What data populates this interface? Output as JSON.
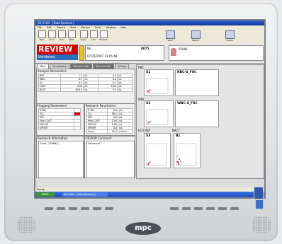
{
  "window": {
    "title": "XE-2100 - [Data Browser]"
  },
  "menubar": {
    "items": [
      "File",
      "Edit",
      "Search",
      "View",
      "Record",
      "Tools",
      "Window",
      "Help"
    ]
  },
  "toolbar": {
    "buttons": [
      "Help",
      "Print",
      "Prev",
      "Next",
      "Query",
      "List",
      "Explore",
      "Valid",
      "Search",
      "Graph"
    ]
  },
  "header": {
    "review": "REVIEW",
    "validated": "Validated",
    "sample_no_label": "No.",
    "sample_no": "0075",
    "datetime": "07/25/2007  23:05:48",
    "patient_id": "55005"
  },
  "tabs": [
    "Main",
    "Cumulative",
    "Research(W)",
    "Research(R)",
    "Q-Flag"
  ],
  "analysis": {
    "title": "Analysis Parameters",
    "rows": [
      [
        "RBC",
        "1.1",
        "/uL",
        "0.0",
        "/uL"
      ],
      [
        "WBC",
        "0.1",
        "/uL",
        "0.0",
        "/uL"
      ],
      [
        "SC",
        "0.1",
        "/uL",
        "0.1",
        "/uL"
      ],
      [
        "CAST",
        "0.00",
        "/uL",
        "0.00",
        "/uL"
      ],
      [
        "BACT",
        "628.4",
        "/uL",
        "0.0",
        "/uL"
      ]
    ]
  },
  "flagging": {
    "title": "Flagging Parameters",
    "rows": [
      "X'TAL",
      "YLC",
      "SRC",
      "Path.CAST",
      "MUCUS",
      "SPERM"
    ]
  },
  "research": {
    "title": "Research Parameters",
    "rows": [
      [
        "X'TAL",
        "0.0",
        "/uL"
      ],
      [
        "YLC",
        "36.1",
        "/uL"
      ],
      [
        "SRC",
        "0.0",
        "/uL"
      ],
      [
        "Path.CAST",
        "0.00",
        "/uL"
      ],
      [
        "MUCUS",
        "0.00",
        "/uL"
      ],
      [
        "SPERM",
        "0.0",
        "/uL"
      ],
      [
        "Cond.",
        "10.3",
        "mS/cm"
      ]
    ]
  },
  "research_info": {
    "title": "Research Information",
    "content": "Cond. [ RANK ]"
  },
  "review_comment": {
    "title": "REVIEW Comment",
    "content": "Universal"
  },
  "charts": [
    {
      "name": "RBC",
      "scatter": "S1",
      "hist": "RBC-S_FSC"
    },
    {
      "name": "WBC",
      "scatter": "S2",
      "hist": "WBC-S_FSC"
    },
    {
      "name": "EC/CAST",
      "scatter": "S3"
    },
    {
      "name": "BACT",
      "scatter": "B1"
    }
  ],
  "status_bar": {
    "text": "Ready"
  },
  "taskbar": {
    "start": "start",
    "task": "XE-2100 - [Data Browser]"
  },
  "monitor": {
    "brand": "mpc"
  },
  "colors": {
    "review_bg": "#d30000",
    "validated_bg": "#2a6bc0",
    "accent": "#1f4fc2"
  }
}
